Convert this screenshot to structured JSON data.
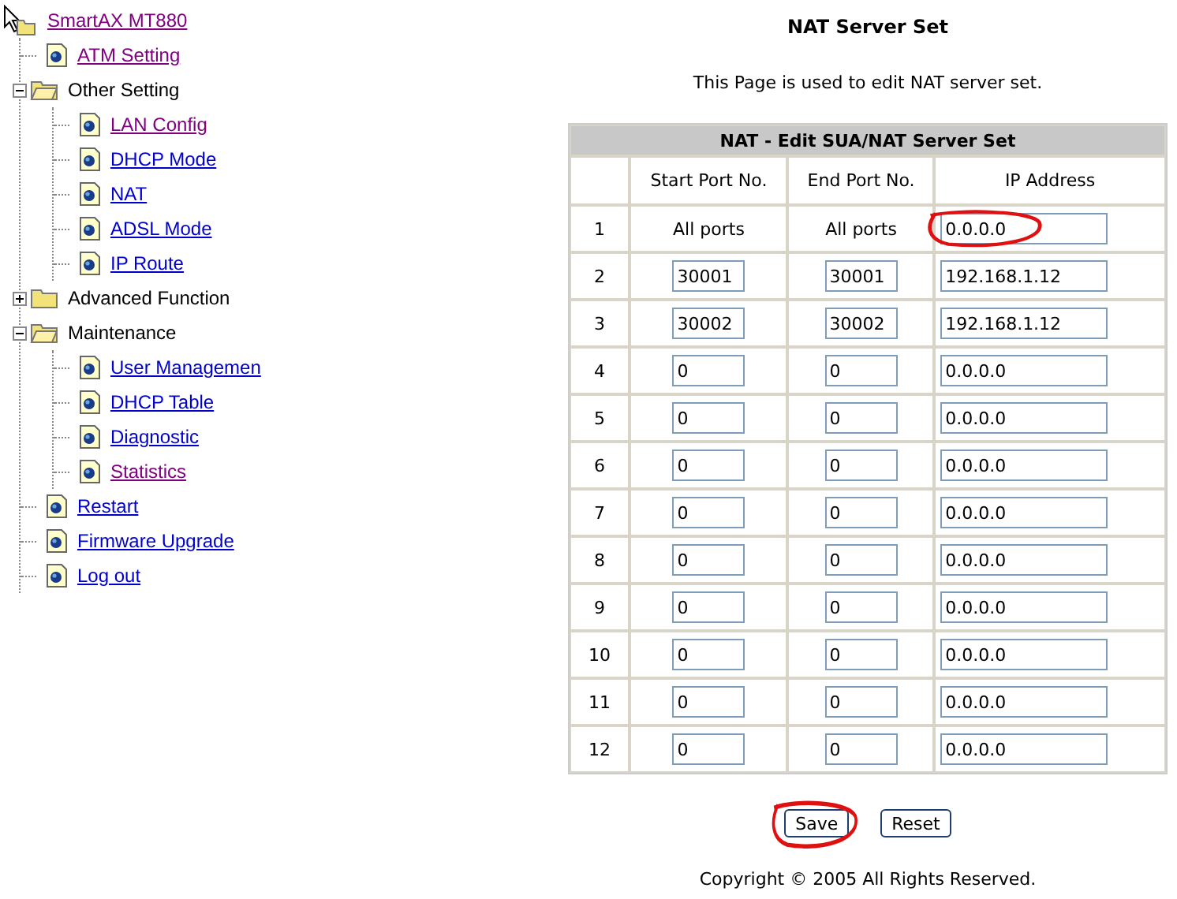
{
  "tree": {
    "label": "SmartAX MT880",
    "visited": true,
    "children": [
      {
        "kind": "page",
        "label": "ATM Setting",
        "visited": true
      },
      {
        "kind": "folder",
        "label": "Other Setting",
        "expanded": true,
        "children": [
          {
            "kind": "page",
            "label": "LAN Config",
            "visited": true
          },
          {
            "kind": "page",
            "label": "DHCP Mode",
            "visited": false
          },
          {
            "kind": "page",
            "label": "NAT",
            "visited": false
          },
          {
            "kind": "page",
            "label": "ADSL Mode",
            "visited": false
          },
          {
            "kind": "page",
            "label": "IP Route",
            "visited": false
          }
        ]
      },
      {
        "kind": "folder",
        "label": "Advanced Function",
        "expanded": false
      },
      {
        "kind": "folder",
        "label": "Maintenance",
        "expanded": true,
        "children": [
          {
            "kind": "page",
            "label": "User Managemen",
            "visited": false
          },
          {
            "kind": "page",
            "label": "DHCP Table",
            "visited": false
          },
          {
            "kind": "page",
            "label": "Diagnostic",
            "visited": false
          },
          {
            "kind": "page",
            "label": "Statistics",
            "visited": true
          }
        ]
      },
      {
        "kind": "page",
        "label": "Restart",
        "visited": false
      },
      {
        "kind": "page",
        "label": "Firmware Upgrade",
        "visited": false
      },
      {
        "kind": "page",
        "label": "Log out",
        "visited": false
      }
    ]
  },
  "page": {
    "title": "NAT Server Set",
    "description": "This Page is used to edit NAT server set."
  },
  "table": {
    "title": "NAT - Edit SUA/NAT Server Set",
    "columns": [
      "Start Port No.",
      "End Port No.",
      "IP Address"
    ],
    "rows": [
      {
        "kind": "all",
        "number": "1",
        "start": "All ports",
        "end": "All ports",
        "ip": "0.0.0.0",
        "annotated": true
      },
      {
        "kind": "fields",
        "number": "2",
        "start": "30001",
        "end": "30001",
        "ip": "192.168.1.12",
        "annotated": false
      },
      {
        "kind": "fields",
        "number": "3",
        "start": "30002",
        "end": "30002",
        "ip": "192.168.1.12",
        "annotated": false
      },
      {
        "kind": "fields",
        "number": "4",
        "start": "0",
        "end": "0",
        "ip": "0.0.0.0",
        "annotated": false
      },
      {
        "kind": "fields",
        "number": "5",
        "start": "0",
        "end": "0",
        "ip": "0.0.0.0",
        "annotated": false
      },
      {
        "kind": "fields",
        "number": "6",
        "start": "0",
        "end": "0",
        "ip": "0.0.0.0",
        "annotated": false
      },
      {
        "kind": "fields",
        "number": "7",
        "start": "0",
        "end": "0",
        "ip": "0.0.0.0",
        "annotated": false
      },
      {
        "kind": "fields",
        "number": "8",
        "start": "0",
        "end": "0",
        "ip": "0.0.0.0",
        "annotated": false
      },
      {
        "kind": "fields",
        "number": "9",
        "start": "0",
        "end": "0",
        "ip": "0.0.0.0",
        "annotated": false
      },
      {
        "kind": "fields",
        "number": "10",
        "start": "0",
        "end": "0",
        "ip": "0.0.0.0",
        "annotated": false
      },
      {
        "kind": "fields",
        "number": "11",
        "start": "0",
        "end": "0",
        "ip": "0.0.0.0",
        "annotated": false
      },
      {
        "kind": "fields",
        "number": "12",
        "start": "0",
        "end": "0",
        "ip": "0.0.0.0",
        "annotated": false
      }
    ]
  },
  "buttons": [
    {
      "label": "Save",
      "annotated": true
    },
    {
      "label": "Reset",
      "annotated": false
    }
  ],
  "footer": "Copyright © 2005 All Rights Reserved."
}
